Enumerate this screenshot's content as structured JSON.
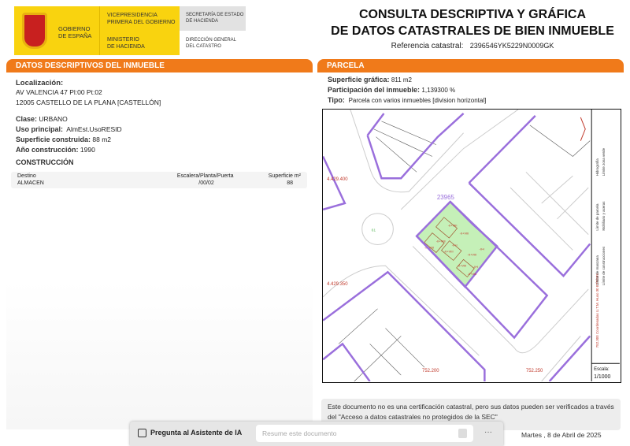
{
  "header": {
    "gov1": "GOBIERNO",
    "gov2": "DE ESPAÑA",
    "vp1": "VICEPRESIDENCIA",
    "vp2": "PRIMERA DEL GOBIERNO",
    "min1": "MINISTERIO",
    "min2": "DE HACIENDA",
    "sec1": "SECRETARÍA DE ESTADO",
    "sec2": "DE HACIENDA",
    "dir1": "DIRECCIÓN GENERAL",
    "dir2": "DEL CATASTRO",
    "title1": "CONSULTA DESCRIPTIVA Y GRÁFICA",
    "title2": "DE DATOS CATASTRALES DE BIEN INMUEBLE",
    "ref_label": "Referencia catastral:",
    "ref_value": "2396546YK5229N0009GK"
  },
  "left": {
    "header": "DATOS DESCRIPTIVOS DEL INMUEBLE",
    "loc_label": "Localización:",
    "loc1": "AV VALENCIA 47 Pl:00 Pt:02",
    "loc2": "12005 CASTELLO DE LA PLANA [CASTELLÓN]",
    "clase_label": "Clase:",
    "clase": "URBANO",
    "uso_label": "Uso principal:",
    "uso": "AlmEst.UsoRESID",
    "sup_label": "Superficie construida:",
    "sup": "88 m2",
    "ano_label": "Año construcción:",
    "ano": "1990",
    "constr_title": "CONSTRUCCIÓN",
    "columns": [
      "Destino",
      "Escalera/Planta/Puerta",
      "Superficie m²"
    ],
    "rows": [
      [
        "ALMACEN",
        "/00/02",
        "88"
      ]
    ]
  },
  "right": {
    "header": "PARCELA",
    "supg_label": "Superficie gráfica:",
    "supg": "811 m2",
    "part_label": "Participación del inmueble:",
    "part": "1,139300 %",
    "tipo_label": "Tipo:",
    "tipo": "Parcela con varios inmuebles [division horizontal]"
  },
  "map": {
    "parcel_id": "23965",
    "y1": "4.429.400",
    "y2": "4.429.350",
    "x1": "752.200",
    "x2": "752.250",
    "legend_coords": "752.300 Coordenadas U.T.M. Huso 30 ETRS89",
    "legend": [
      "Límite de manzana",
      "Límite de construcciones",
      "Límite de parcela",
      "Mobiliario y aceras",
      "Hidrografía",
      "Límite zona verde"
    ],
    "scale_label": "Escala:",
    "scale": "1/1000",
    "colors": {
      "parcel": "#c5f0b8",
      "boundary": "#9a6fdc",
      "labels": "#c0392b"
    }
  },
  "notice": "Este documento no es una certificación catastral, pero sus datos pueden ser verificados a través del \"Acceso a datos catastrales no protegidos de la SEC\"",
  "date": "Martes , 8 de Abril de 2025",
  "assistant": {
    "label": "Pregunta al Asistente de IA",
    "placeholder": "Resume este documento",
    "more": "···"
  }
}
